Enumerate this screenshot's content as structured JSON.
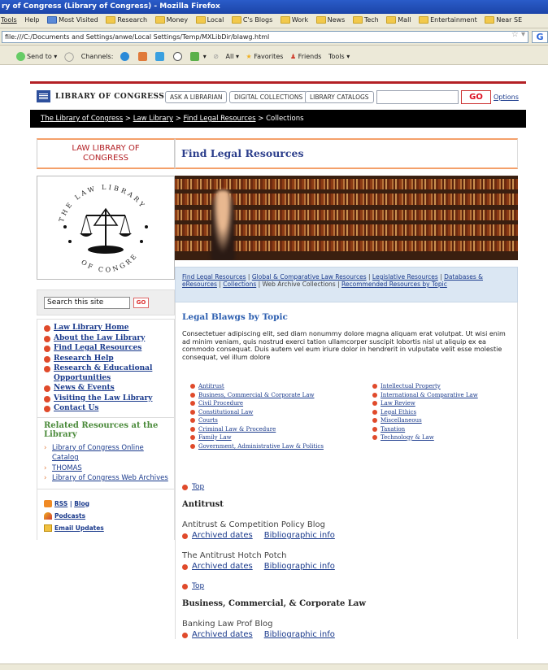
{
  "browser": {
    "title": "ry of Congress (Library of Congress) - Mozilla Firefox",
    "menu": [
      "Tools",
      "Help"
    ],
    "bookmarks": [
      "Most Visited",
      "Research",
      "Money",
      "Local",
      "C's Blogs",
      "Work",
      "News",
      "Tech",
      "Mall",
      "Entertainment",
      "Near SE"
    ],
    "url": "file:///C:/Documents and Settings/anwe/Local Settings/Temp/MXLibDir/blawg.html",
    "go_letter": "G",
    "toolbar": {
      "send_to": "Send to",
      "channels": "Channels:",
      "all": "All",
      "favorites": "Favorites",
      "friends": "Friends",
      "tools": "Tools"
    }
  },
  "header": {
    "logo": "LIBRARY OF CONGRESS",
    "buttons": [
      "ASK A LIBRARIAN",
      "DIGITAL COLLECTIONS",
      "LIBRARY CATALOGS"
    ],
    "search_placeholder": "",
    "go": "GO",
    "options": "Options"
  },
  "breadcrumb": {
    "items": [
      "The Library of Congress",
      "Law Library",
      "Find Legal Resources"
    ],
    "current": "Collections",
    "sep": " > "
  },
  "sidebar": {
    "title_line1": "LAW LIBRARY OF",
    "title_line2": "CONGRESS",
    "seal_top": "THE LAW LIBRARY",
    "seal_bottom": "OF CONGRESS",
    "search_value": "Search this site",
    "search_go": "GO",
    "nav": [
      "Law Library Home",
      "About the Law Library",
      "Find Legal Resources",
      "Research Help",
      "Research & Educational Opportunities",
      "News & Events",
      "Visiting the Law Library",
      "Contact Us"
    ],
    "related_title": "Related Resources at the Library",
    "related": [
      "Library of Congress Online Catalog",
      "THOMAS",
      "Library of Congress Web Archives"
    ],
    "rss": "RSS",
    "blog": "Blog",
    "podcasts": "Podcasts",
    "email": "Email Updates"
  },
  "main": {
    "title": "Find Legal Resources",
    "subnav": {
      "links": [
        "Find Legal Resources",
        "Global & Comparative Law Resources",
        "Legislative Resources",
        "Databases & eResources",
        "Collections"
      ],
      "current": "Web Archive Collections",
      "last": "Recommended Resources by Topic"
    },
    "section_title": "Legal Blawgs by Topic",
    "intro": "Consectetuer adipiscing elit, sed diam nonummy dolore magna aliquam erat volutpat. Ut wisi enim ad minim veniam, quis nostrud exerci tation ullamcorper suscipit lobortis nisl ut aliquip ex ea commodo consequat. Duis autem vel eum iriure dolor in hendrerit in vulputate velit esse molestie consequat, vel illum dolore",
    "topics_left": [
      "Antitrust",
      "Business, Commercial & Corporate Law",
      "Civil Procedure",
      "Constitutional Law",
      "Courts",
      "Criminal Law & Procedure",
      "Family Law",
      "Government, Administrative Law & Politics"
    ],
    "topics_right": [
      "Intellectual Property",
      "International & Comparative Law",
      "Law Review",
      "Legal Ethics",
      "Miscellaneous",
      "Taxation",
      "Technology & Law"
    ],
    "top": "Top",
    "sections": [
      {
        "heading": "Antitrust",
        "blogs": [
          {
            "name": "Antitrust & Competition Policy Blog",
            "l1": "Archived dates",
            "l2": "Bibliographic info"
          },
          {
            "name": "The Antitrust Hotch Potch",
            "l1": "Archived dates",
            "l2": "Bibliographic info"
          }
        ]
      },
      {
        "heading": "Business, Commercial, & Corporate Law",
        "blogs": [
          {
            "name": "Banking Law Prof Blog",
            "l1": "Archived dates",
            "l2": "Bibliographic info"
          }
        ]
      }
    ]
  }
}
